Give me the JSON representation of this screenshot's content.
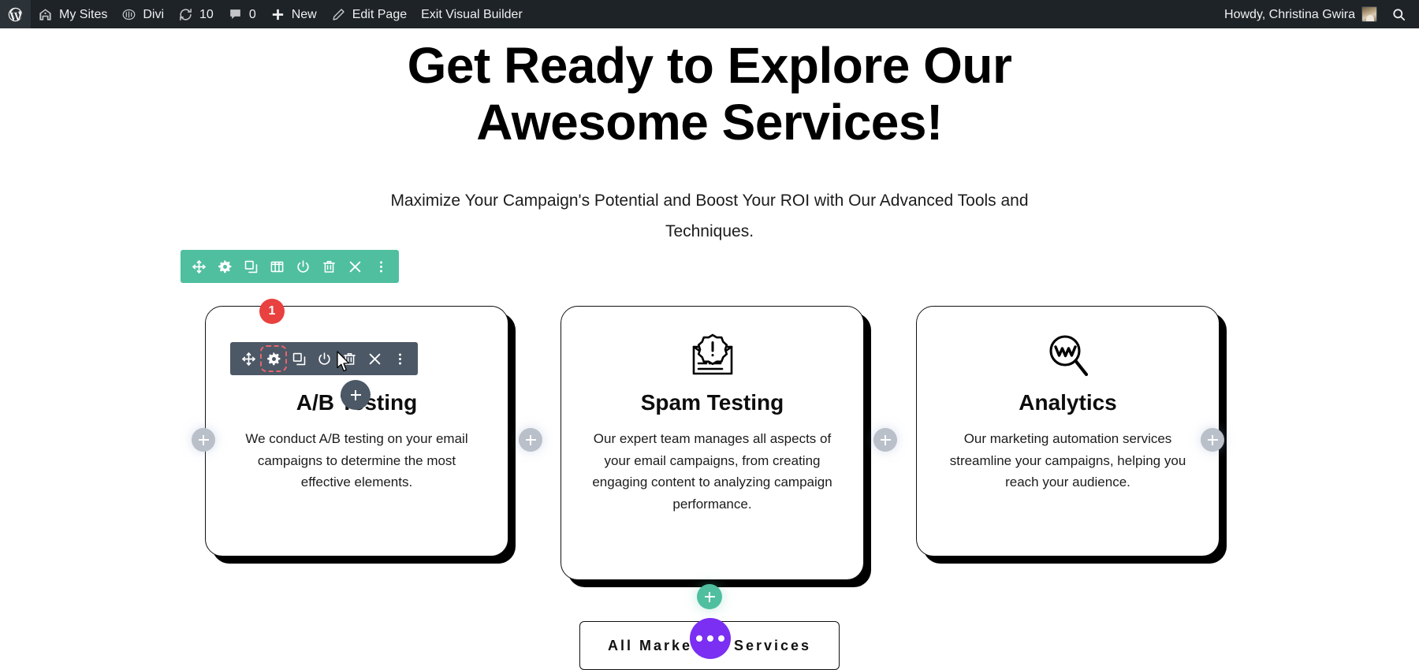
{
  "admin_bar": {
    "items": [
      {
        "icon": "wordpress-logo-icon",
        "label": ""
      },
      {
        "icon": "sites-icon",
        "label": "My Sites"
      },
      {
        "icon": "divi-icon",
        "label": "Divi"
      },
      {
        "icon": "updates-icon",
        "label": "10"
      },
      {
        "icon": "comments-icon",
        "label": "0"
      },
      {
        "icon": "plus-icon",
        "label": "New"
      },
      {
        "icon": "pencil-icon",
        "label": "Edit Page"
      },
      {
        "icon": "",
        "label": "Exit Visual Builder"
      }
    ],
    "howdy": "Howdy, Christina Gwira",
    "search_icon": "search-icon"
  },
  "hero": {
    "heading": "Get Ready to Explore Our Awesome Services!",
    "subheading": "Maximize Your Campaign's Potential and Boost Your ROI with Our Advanced Tools and Techniques."
  },
  "section_toolbar": {
    "color": "#4fbf9f",
    "buttons": [
      {
        "name": "move-icon",
        "title": "Move Section"
      },
      {
        "name": "gear-icon",
        "title": "Section Settings"
      },
      {
        "name": "duplicate-icon",
        "title": "Duplicate Section"
      },
      {
        "name": "columns-icon",
        "title": "Change Column Structure"
      },
      {
        "name": "power-icon",
        "title": "Disable Section"
      },
      {
        "name": "trash-icon",
        "title": "Delete Section"
      },
      {
        "name": "close-icon",
        "title": "Close"
      },
      {
        "name": "more-options-icon",
        "title": "More Options"
      }
    ]
  },
  "module_toolbar": {
    "color": "#4c5866",
    "badge": "1",
    "badge_color": "#e8413f",
    "selected_index": 1,
    "buttons": [
      {
        "name": "move-icon",
        "title": "Move Module"
      },
      {
        "name": "gear-icon",
        "title": "Module Settings"
      },
      {
        "name": "duplicate-icon",
        "title": "Duplicate Module"
      },
      {
        "name": "power-icon",
        "title": "Disable Module"
      },
      {
        "name": "trash-icon",
        "title": "Delete Module"
      },
      {
        "name": "close-icon",
        "title": "Close"
      },
      {
        "name": "more-options-icon",
        "title": "More Options"
      }
    ]
  },
  "cards": [
    {
      "icon": "none",
      "title": "A/B Testing",
      "description": "We conduct A/B testing on your email campaigns to determine the most effective elements."
    },
    {
      "icon": "spam-envelope-icon",
      "title": "Spam Testing",
      "description": "Our expert team manages all aspects of your email campaigns, from creating engaging content to analyzing campaign performance."
    },
    {
      "icon": "analytics-magnifier-icon",
      "title": "Analytics",
      "description": "Our marketing automation services streamline your campaigns, helping you reach your audience."
    }
  ],
  "cta": {
    "label": "All Marketing Services",
    "spinner_color": "#7b2ff2"
  },
  "add_buttons": {
    "module_add_label": "+",
    "row_add_label": "+",
    "section_add_label": "+",
    "row_add_color": "#b9c0c9",
    "section_add_color": "#4fbf9f"
  }
}
